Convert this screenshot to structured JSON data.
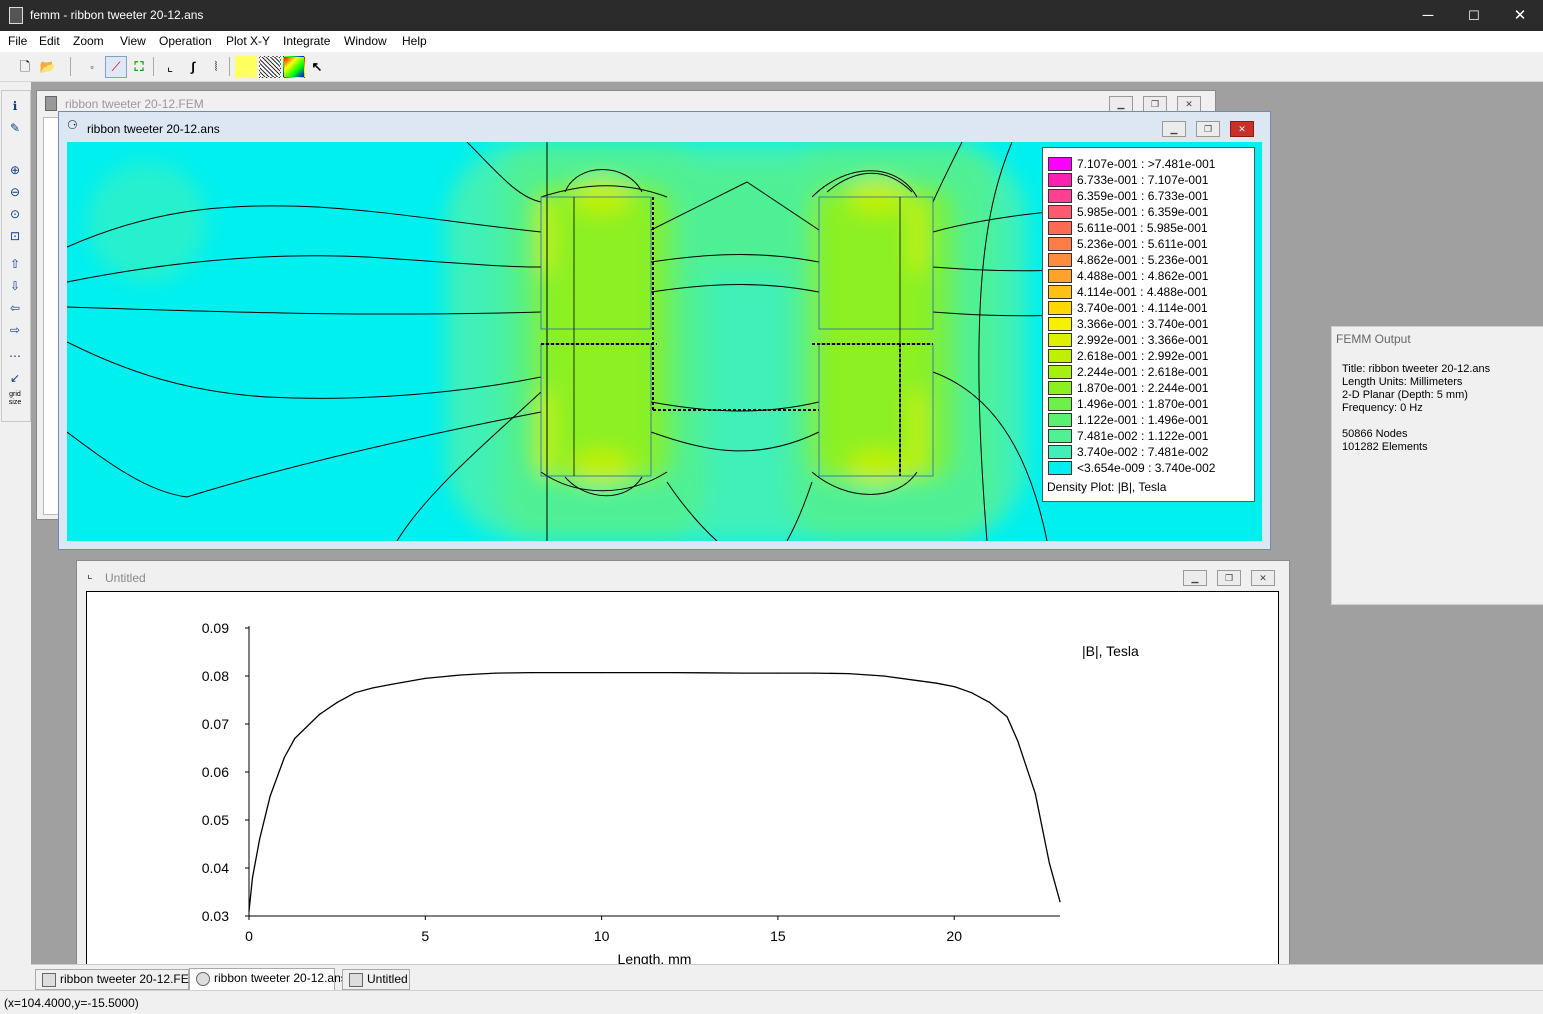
{
  "window": {
    "title": "femm - ribbon tweeter 20-12.ans",
    "minimize": "─",
    "maximize": "☐",
    "close": "✕"
  },
  "menu": [
    "File",
    "Edit",
    "Zoom",
    "View",
    "Operation",
    "Plot X-Y",
    "Integrate",
    "Window",
    "Help"
  ],
  "toolbar": [
    "new-doc-icon",
    "open-folder-icon",
    "node-mode-icon",
    "segment-mode-icon",
    "block-mode-icon",
    "plot-xy-icon",
    "integrate-icon",
    "line-integral-icon",
    "density-plot-icon",
    "hatch-icon",
    "vector-plot-icon",
    "arrow-select-icon"
  ],
  "lefttoolbar": [
    "ℹ",
    "✎",
    "⊕",
    "⊖",
    "⊙",
    "⊡",
    "⇧",
    "⇩",
    "⇦",
    "⇨",
    "⋯",
    "↙",
    "grid size"
  ],
  "fem_window": {
    "title": "ribbon tweeter 20-12.FEM"
  },
  "ans_window": {
    "title": "ribbon tweeter 20-12.ans",
    "legend": {
      "entries": [
        {
          "label": "7.107e-001 : >7.481e-001",
          "color": "#ff00ff"
        },
        {
          "label": "6.733e-001 : 7.107e-001",
          "color": "#ff1fb0"
        },
        {
          "label": "6.359e-001 : 6.733e-001",
          "color": "#ff3f92"
        },
        {
          "label": "5.985e-001 : 6.359e-001",
          "color": "#ff5a6e"
        },
        {
          "label": "5.611e-001 : 5.985e-001",
          "color": "#ff6a55"
        },
        {
          "label": "5.236e-001 : 5.611e-001",
          "color": "#ff7c46"
        },
        {
          "label": "4.862e-001 : 5.236e-001",
          "color": "#ff8c3c"
        },
        {
          "label": "4.488e-001 : 4.862e-001",
          "color": "#ffa428"
        },
        {
          "label": "4.114e-001 : 4.488e-001",
          "color": "#ffc014"
        },
        {
          "label": "3.740e-001 : 4.114e-001",
          "color": "#ffd800"
        },
        {
          "label": "3.366e-001 : 3.740e-001",
          "color": "#f5f000"
        },
        {
          "label": "2.992e-001 : 3.366e-001",
          "color": "#dcf000"
        },
        {
          "label": "2.618e-001 : 2.992e-001",
          "color": "#c0f000"
        },
        {
          "label": "2.244e-001 : 2.618e-001",
          "color": "#a6f010"
        },
        {
          "label": "1.870e-001 : 2.244e-001",
          "color": "#8cf020"
        },
        {
          "label": "1.496e-001 : 1.870e-001",
          "color": "#6ef04a"
        },
        {
          "label": "1.122e-001 : 1.496e-001",
          "color": "#5af070"
        },
        {
          "label": "7.481e-002 : 1.122e-001",
          "color": "#50f095"
        },
        {
          "label": "3.740e-002 : 7.481e-002",
          "color": "#40f0b8"
        },
        {
          "label": "<3.654e-009 : 3.740e-002",
          "color": "#00f0f0"
        }
      ],
      "caption": "Density Plot: |B|, Tesla"
    }
  },
  "plot_window": {
    "title": "Untitled"
  },
  "chart_data": {
    "type": "line",
    "title": "",
    "legend_label": "|B|, Tesla",
    "xlabel": "Length, mm",
    "ylabel": "",
    "xlim": [
      0,
      23
    ],
    "ylim": [
      0.03,
      0.09
    ],
    "xticks": [
      "0",
      "5",
      "10",
      "15",
      "20"
    ],
    "yticks": [
      "0.09",
      "0.08",
      "0.07",
      "0.06",
      "0.05",
      "0.04",
      "0.03"
    ],
    "series": [
      {
        "x": [
          0,
          0.1,
          0.3,
          0.6,
          1.0,
          1.3,
          2.0,
          2.5,
          3.0,
          3.5,
          4.0,
          5.0,
          6.0,
          7.0,
          8.0,
          10,
          12,
          14,
          15,
          16,
          17,
          18,
          19,
          19.5,
          20,
          20.5,
          21,
          21.5,
          21.8,
          22.3,
          22.7,
          23
        ],
        "values": [
          0.031,
          0.038,
          0.046,
          0.055,
          0.063,
          0.067,
          0.072,
          0.0745,
          0.0765,
          0.0775,
          0.0782,
          0.0795,
          0.0802,
          0.0806,
          0.0807,
          0.0807,
          0.0807,
          0.0806,
          0.0806,
          0.0806,
          0.0805,
          0.08,
          0.079,
          0.0785,
          0.0778,
          0.0765,
          0.0745,
          0.0715,
          0.0665,
          0.0555,
          0.041,
          0.033
        ]
      }
    ]
  },
  "output": {
    "header": "FEMM Output",
    "lines": "Title: ribbon tweeter 20-12.ans\nLength Units: Millimeters\n2-D Planar (Depth: 5 mm)\nFrequency: 0 Hz\n\n50866 Nodes\n101282 Elements"
  },
  "tabs": [
    "ribbon tweeter 20-12.FEM",
    "ribbon tweeter 20-12.ans",
    "Untitled"
  ],
  "status": "(x=104.4000,y=-15.5000)"
}
